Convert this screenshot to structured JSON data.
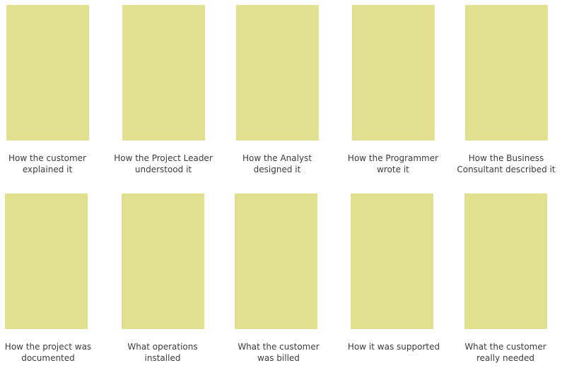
{
  "card_color": "#e0e08f",
  "panels": [
    {
      "line1": "How the customer",
      "line2": "explained it"
    },
    {
      "line1": "How the Project Leader",
      "line2": "understood it"
    },
    {
      "line1": "How the Analyst",
      "line2": "designed it"
    },
    {
      "line1": "How the Programmer",
      "line2": "wrote it"
    },
    {
      "line1": "How the Business",
      "line2": "Consultant described it"
    },
    {
      "line1": "How the project was",
      "line2": "documented"
    },
    {
      "line1": "What operations",
      "line2": "installed"
    },
    {
      "line1": "What the customer",
      "line2": "was billed"
    },
    {
      "line1": "How it was supported",
      "line2": ""
    },
    {
      "line1": "What the customer",
      "line2": "really needed"
    }
  ]
}
